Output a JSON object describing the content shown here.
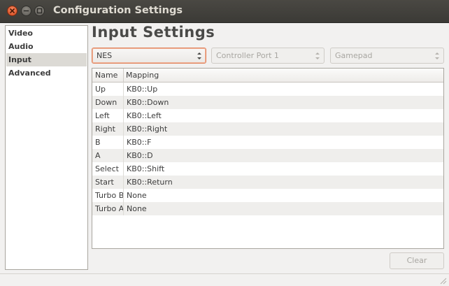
{
  "window": {
    "title": "Configuration Settings"
  },
  "sidebar": {
    "items": [
      {
        "label": "Video",
        "selected": false
      },
      {
        "label": "Audio",
        "selected": false
      },
      {
        "label": "Input",
        "selected": true
      },
      {
        "label": "Advanced",
        "selected": false
      }
    ]
  },
  "main": {
    "heading": "Input Settings",
    "system_select": {
      "value": "NES",
      "enabled": true
    },
    "port_select": {
      "value": "Controller Port 1",
      "enabled": false
    },
    "device_select": {
      "value": "Gamepad",
      "enabled": false
    },
    "table": {
      "columns": [
        "Name",
        "Mapping"
      ],
      "rows": [
        {
          "name": "Up",
          "mapping": "KB0::Up"
        },
        {
          "name": "Down",
          "mapping": "KB0::Down"
        },
        {
          "name": "Left",
          "mapping": "KB0::Left"
        },
        {
          "name": "Right",
          "mapping": "KB0::Right"
        },
        {
          "name": "B",
          "mapping": "KB0::F"
        },
        {
          "name": "A",
          "mapping": "KB0::D"
        },
        {
          "name": "Select",
          "mapping": "KB0::Shift"
        },
        {
          "name": "Start",
          "mapping": "KB0::Return"
        },
        {
          "name": "Turbo B",
          "mapping": "None"
        },
        {
          "name": "Turbo A",
          "mapping": "None"
        }
      ]
    },
    "clear_label": "Clear",
    "clear_enabled": false
  },
  "colors": {
    "titlebar": "#3c3b37",
    "close_button": "#e05a2b",
    "focus_border": "#e0835d",
    "selection": "#dcdad5"
  }
}
